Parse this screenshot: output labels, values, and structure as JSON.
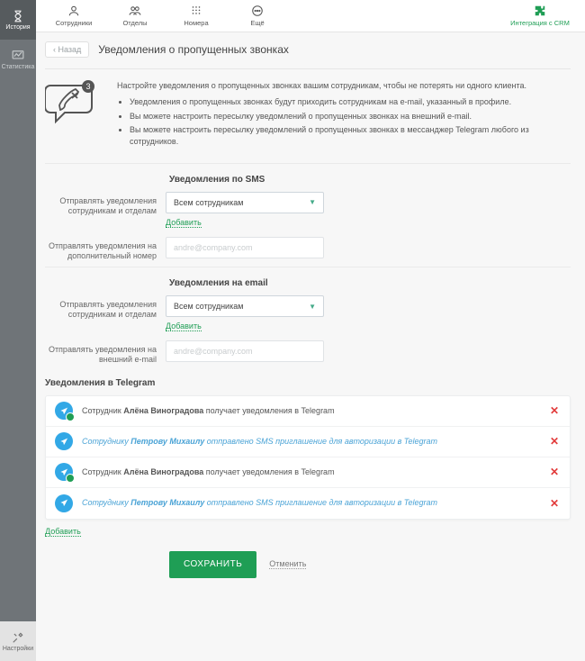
{
  "rail": {
    "history": "История",
    "stats": "Статистика",
    "settings": "Настройки"
  },
  "top": {
    "employees": "Сотрудники",
    "departments": "Отделы",
    "numbers": "Номера",
    "more": "Ещё",
    "crm": "Интеграция с CRM"
  },
  "header": {
    "back": "Назад",
    "title": "Уведомления о пропущенных звонках"
  },
  "intro": {
    "lead": "Настройте уведомления о пропущенных звонках вашим сотрудникам, чтобы не потерять ни одного клиента.",
    "b1": "Уведомления о пропущенных звонках будут приходить сотрудникам на e-mail, указанный в профиле.",
    "b2": "Вы можете настроить пересылку уведомлений о пропущенных звонках на внешний e-mail.",
    "b3": "Вы можете настроить пересылку уведомлений о пропущенных звонках в мессанджер Telegram любого из сотрудников."
  },
  "sms": {
    "heading": "Уведомления по SMS",
    "label1": "Отправлять уведомления сотрудникам и отделам",
    "select_value": "Всем сотрудникам",
    "add": "Добавить",
    "label2": "Отправлять уведомления на дополнительный номер",
    "placeholder": "andre@company.com"
  },
  "email": {
    "heading": "Уведомления на email",
    "label1": "Отправлять уведомления сотрудникам и отделам",
    "select_value": "Всем сотрудникам",
    "add": "Добавить",
    "label2": "Отправлять уведомления на внешний e-mail",
    "placeholder": "andre@company.com"
  },
  "telegram": {
    "heading": "Уведомления в Telegram",
    "rows": [
      {
        "pre": "Сотрудник ",
        "name": "Алёна Виноградова",
        "post": " получает уведомления в Telegram",
        "ok": true,
        "pending": false
      },
      {
        "pre": "Сотруднику ",
        "name": "Петрову Михаилу",
        "post": " отправлено SMS приглашение для авторизации в Telegram",
        "ok": false,
        "pending": true
      },
      {
        "pre": "Сотрудник ",
        "name": "Алёна Виноградова",
        "post": " получает уведомления в Telegram",
        "ok": true,
        "pending": false
      },
      {
        "pre": "Сотруднику ",
        "name": "Петрову Михаилу",
        "post": " отправлено SMS приглашение для авторизации в Telegram",
        "ok": false,
        "pending": true
      }
    ],
    "add": "Добавить"
  },
  "footer": {
    "save": "СОХРАНИТЬ",
    "cancel": "Отменить"
  },
  "badge_count": "3"
}
